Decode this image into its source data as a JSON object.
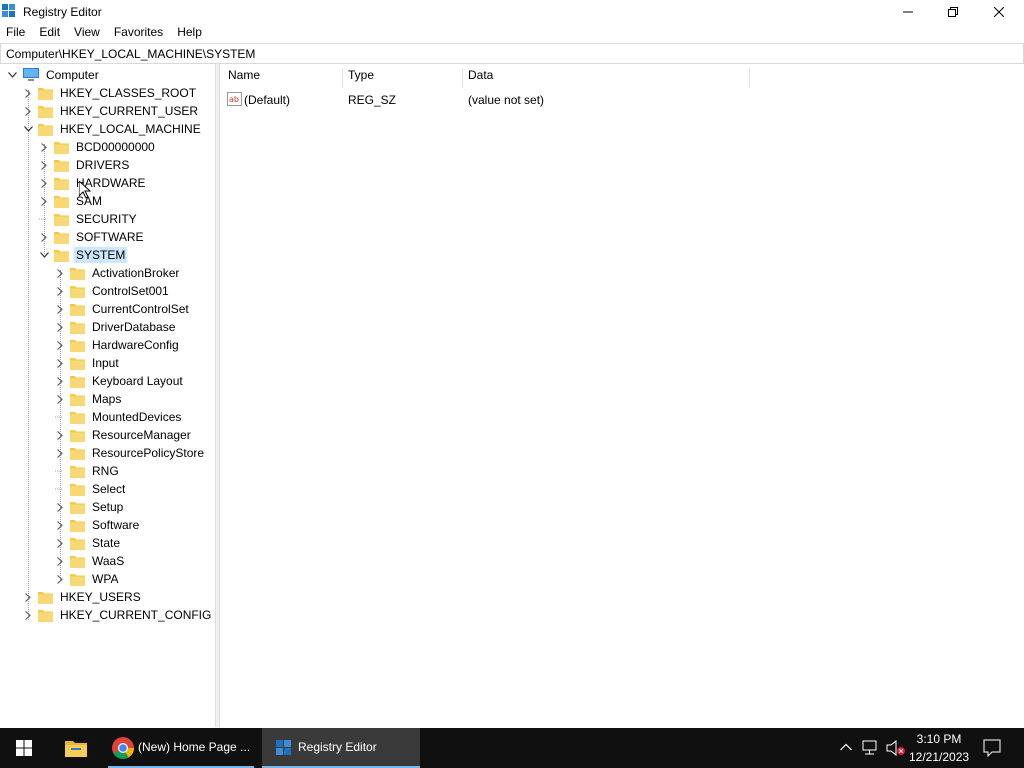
{
  "window": {
    "title": "Registry Editor",
    "app_icon": "registry-icon",
    "controls": {
      "minimize": "minimize-icon",
      "restore": "restore-icon",
      "close": "close-icon"
    }
  },
  "menu": [
    "File",
    "Edit",
    "View",
    "Favorites",
    "Help"
  ],
  "address": "Computer\\HKEY_LOCAL_MACHINE\\SYSTEM",
  "tree": {
    "root": "Computer",
    "hives": {
      "classes_root": "HKEY_CLASSES_ROOT",
      "current_user": "HKEY_CURRENT_USER",
      "local_machine": "HKEY_LOCAL_MACHINE",
      "users": "HKEY_USERS",
      "current_config": "HKEY_CURRENT_CONFIG"
    },
    "hklm_children": [
      "BCD00000000",
      "DRIVERS",
      "HARDWARE",
      "SAM",
      "SECURITY",
      "SOFTWARE",
      "SYSTEM"
    ],
    "system_children": [
      "ActivationBroker",
      "ControlSet001",
      "CurrentControlSet",
      "DriverDatabase",
      "HardwareConfig",
      "Input",
      "Keyboard Layout",
      "Maps",
      "MountedDevices",
      "ResourceManager",
      "ResourcePolicyStore",
      "RNG",
      "Select",
      "Setup",
      "Software",
      "State",
      "WaaS",
      "WPA"
    ],
    "selected": "SYSTEM"
  },
  "list": {
    "columns": [
      "Name",
      "Type",
      "Data"
    ],
    "rows": [
      {
        "name": "(Default)",
        "type": "REG_SZ",
        "data": "(value not set)",
        "icon": "string-value-icon"
      }
    ]
  },
  "taskbar": {
    "apps": [
      {
        "label": "(New) Home Page ...",
        "icon": "chrome-icon"
      },
      {
        "label": "Registry Editor",
        "icon": "registry-icon"
      }
    ],
    "time": "3:10 PM",
    "date": "12/21/2023"
  },
  "colors": {
    "selection": "#cce8ff",
    "folder": "#f5c94a",
    "taskbar": "#101010"
  }
}
